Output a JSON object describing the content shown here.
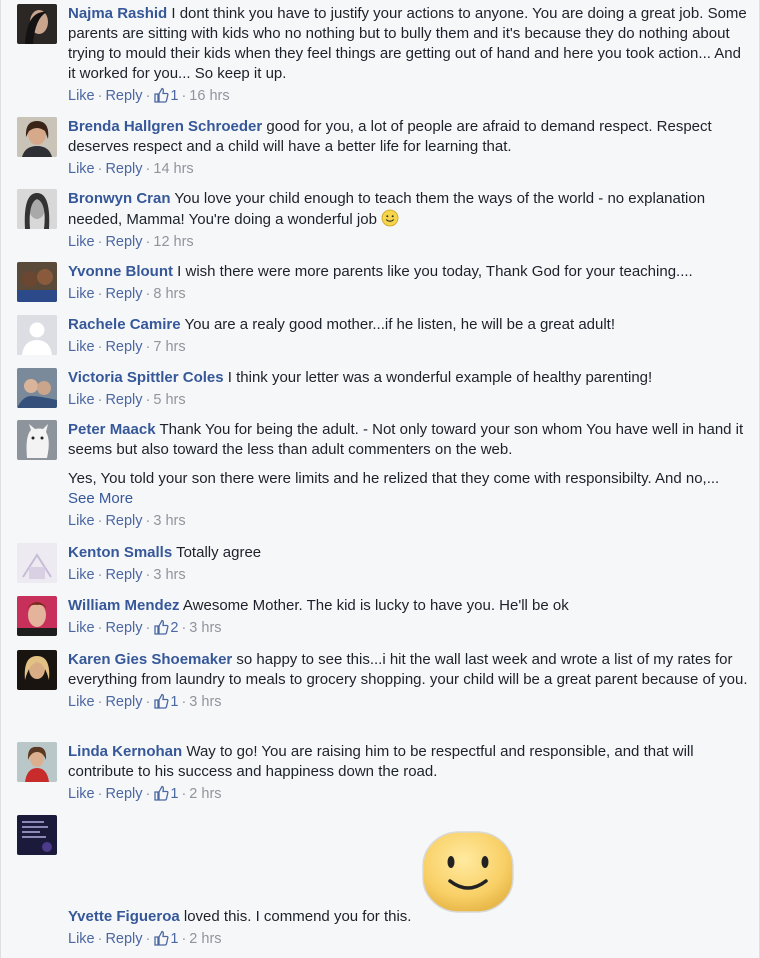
{
  "comments": [
    {
      "name": "Najma Rashid",
      "paragraphs": [
        "I dont think you have to justify your actions to anyone. You are doing a great job. Some parents are sitting with kids who no nothing but to bully them and it's because they do nothing about trying to mould their kids when they feel things are getting out of hand and here you took action... And it worked for you... So keep it up."
      ],
      "like": "Like",
      "reply": "Reply",
      "likes": "1",
      "time": "16 hrs"
    },
    {
      "name": "Brenda Hallgren Schroeder",
      "paragraphs": [
        "good for you, a lot of people are afraid to demand respect. Respect deserves respect and a child will have a better life for learning that."
      ],
      "like": "Like",
      "reply": "Reply",
      "time": "14 hrs"
    },
    {
      "name": "Bronwyn Cran",
      "paragraphs": [
        "You love your child enough to teach them the ways of the world - no explanation needed, Mamma! You're doing a wonderful job"
      ],
      "like": "Like",
      "reply": "Reply",
      "time": "12 hrs"
    },
    {
      "name": "Yvonne Blount",
      "paragraphs": [
        "I wish there were more parents like you today, Thank God for your teaching...."
      ],
      "like": "Like",
      "reply": "Reply",
      "time": "8 hrs"
    },
    {
      "name": "Rachele Camire",
      "paragraphs": [
        "You are a realy good mother...if he listen, he will be a great adult!"
      ],
      "like": "Like",
      "reply": "Reply",
      "time": "7 hrs"
    },
    {
      "name": "Victoria Spittler Coles",
      "paragraphs": [
        "I think your letter was a wonderful example of healthy parenting!"
      ],
      "like": "Like",
      "reply": "Reply",
      "time": "5 hrs"
    },
    {
      "name": "Peter Maack",
      "paragraphs": [
        "Thank You for being the adult. - Not only toward your son whom You have well in hand it seems but also toward the less than adult commenters on the web.",
        "Yes, You told your son there were limits and he relized that they come with responsibilty. And no,..."
      ],
      "see_more": "See More",
      "like": "Like",
      "reply": "Reply",
      "time": "3 hrs"
    },
    {
      "name": "Kenton Smalls",
      "paragraphs": [
        "Totally agree"
      ],
      "like": "Like",
      "reply": "Reply",
      "time": "3 hrs"
    },
    {
      "name": "William Mendez",
      "paragraphs": [
        "Awesome Mother. The kid is lucky to have you. He'll be ok"
      ],
      "like": "Like",
      "reply": "Reply",
      "likes": "2",
      "time": "3 hrs"
    },
    {
      "name": "Karen Gies Shoemaker",
      "paragraphs": [
        "so happy to see this...i hit the wall last week and wrote a list of my rates for everything from laundry to meals to grocery shopping. your child will be a great parent because of you."
      ],
      "like": "Like",
      "reply": "Reply",
      "likes": "1",
      "time": "3 hrs"
    },
    {
      "name": "Linda Kernohan",
      "paragraphs": [
        "Way to go! You are raising him to be respectful and responsible, and that will contribute to his success and happiness down the road."
      ],
      "like": "Like",
      "reply": "Reply",
      "likes": "1",
      "time": "2 hrs"
    },
    {
      "name": "Yvette Figueroa",
      "paragraphs": [
        "loved this. I commend you for this."
      ],
      "like": "Like",
      "reply": "Reply",
      "likes": "1",
      "time": "2 hrs"
    }
  ],
  "colors": {
    "link": "#365899",
    "meta": "#90949c",
    "action_link": "#4b67a1",
    "background": "#f6f7f9"
  },
  "icons": {
    "like": "thumbs-up-icon",
    "emoji": "smiley-emoji-icon",
    "sticker": "smiley-sticker"
  }
}
